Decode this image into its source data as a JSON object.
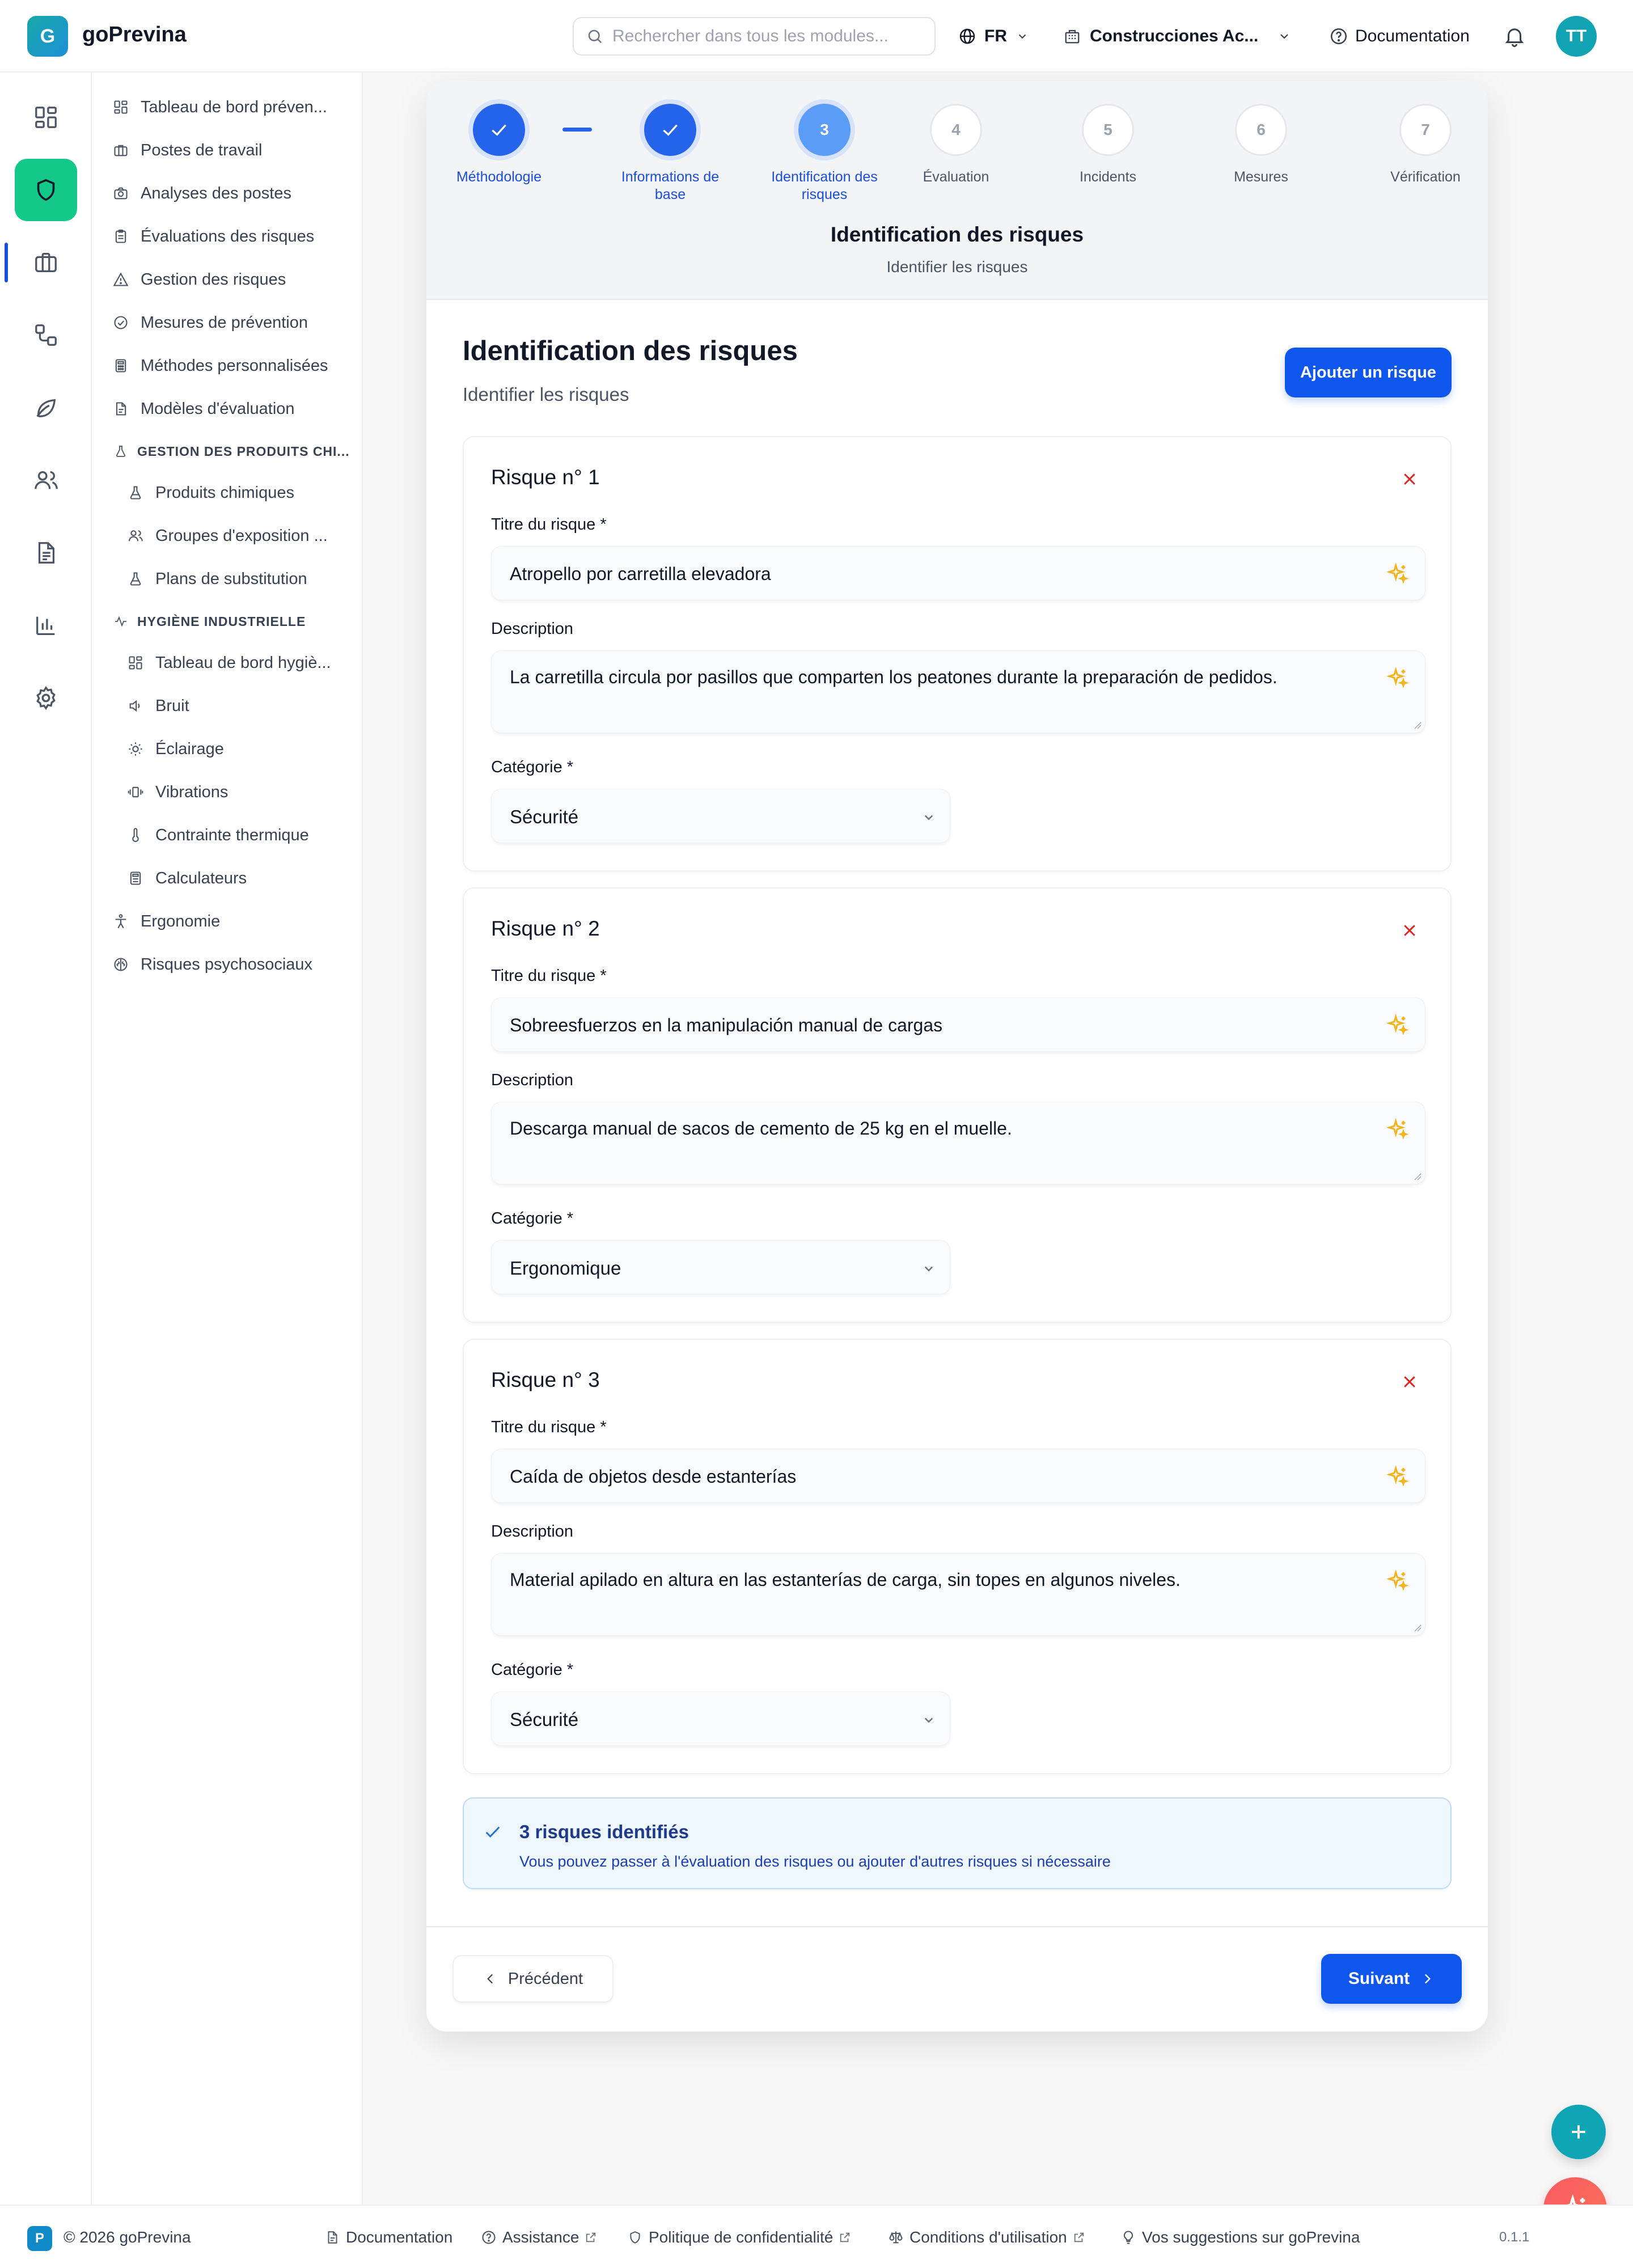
{
  "app": {
    "logo_letter": "G",
    "name": "goPrevina",
    "search_placeholder": "Rechercher dans tous les modules...",
    "language": "FR",
    "company": "Construcciones Ac...",
    "documentation": "Documentation",
    "avatar_initials": "TT"
  },
  "rail": {
    "icons": [
      "dashboard-icon",
      "shield-icon",
      "briefcase-icon",
      "workflow-icon",
      "leaf-icon",
      "users-icon",
      "document-icon",
      "bar-chart-icon",
      "settings-icon"
    ],
    "active_index": 1
  },
  "sidebar": {
    "items": [
      {
        "label": "Tableau de bord préven...",
        "icon": "dashboard-icon"
      },
      {
        "label": "Postes de travail",
        "icon": "briefcase-icon"
      },
      {
        "label": "Analyses des postes",
        "icon": "camera-icon"
      },
      {
        "label": "Évaluations des risques",
        "icon": "clipboard-icon"
      },
      {
        "label": "Gestion des risques",
        "icon": "warning-icon"
      },
      {
        "label": "Mesures de prévention",
        "icon": "check-circle-icon"
      },
      {
        "label": "Méthodes personnalisées",
        "icon": "calculator-icon"
      },
      {
        "label": "Modèles d'évaluation",
        "icon": "document-icon"
      }
    ],
    "chem_section": "GESTION DES PRODUITS CHI...",
    "chem_items": [
      {
        "label": "Produits chimiques",
        "icon": "flask-icon"
      },
      {
        "label": "Groupes d'exposition ...",
        "icon": "users-icon"
      },
      {
        "label": "Plans de substitution",
        "icon": "flask-icon"
      }
    ],
    "hyg_section": "HYGIÈNE INDUSTRIELLE",
    "hyg_items": [
      {
        "label": "Tableau de bord hygiè...",
        "icon": "dashboard-icon"
      },
      {
        "label": "Bruit",
        "icon": "speaker-icon"
      },
      {
        "label": "Éclairage",
        "icon": "sun-icon"
      },
      {
        "label": "Vibrations",
        "icon": "vibration-icon"
      },
      {
        "label": "Contrainte thermique",
        "icon": "thermometer-icon"
      },
      {
        "label": "Calculateurs",
        "icon": "calculator-icon"
      }
    ],
    "bottom_items": [
      {
        "label": "Ergonomie",
        "icon": "person-icon"
      },
      {
        "label": "Risques psychosociaux",
        "icon": "brain-icon"
      }
    ]
  },
  "wizard": {
    "steps": [
      {
        "num": "1",
        "label": "Méthodologie",
        "state": "done"
      },
      {
        "num": "2",
        "label": "Informations de base",
        "state": "done"
      },
      {
        "num": "3",
        "label": "Identification des risques",
        "state": "current"
      },
      {
        "num": "4",
        "label": "Évaluation",
        "state": "todo"
      },
      {
        "num": "5",
        "label": "Incidents",
        "state": "todo"
      },
      {
        "num": "6",
        "label": "Mesures",
        "state": "todo"
      },
      {
        "num": "7",
        "label": "Vérification",
        "state": "todo"
      }
    ],
    "header_title": "Identification des risques",
    "header_subtitle": "Identifier les risques",
    "section_title": "Identification des risques",
    "section_subtitle": "Identifier les risques",
    "add_button": "Ajouter un risque",
    "labels": {
      "title": "Titre du risque *",
      "description": "Description",
      "category": "Catégorie *"
    },
    "risks": [
      {
        "heading": "Risque n° 1",
        "title": "Atropello por carretilla elevadora",
        "description": "La carretilla circula por pasillos que comparten los peatones durante la preparación de pedidos.",
        "category": "Sécurité"
      },
      {
        "heading": "Risque n° 2",
        "title": "Sobreesfuerzos en la manipulación manual de cargas",
        "description": "Descarga manual de sacos de cemento de 25 kg en el muelle.",
        "category": "Ergonomique"
      },
      {
        "heading": "Risque n° 3",
        "title": "Caída de objetos desde estanterías",
        "description": "Material apilado en altura en las estanterías de carga, sin topes en algunos niveles.",
        "category": "Sécurité"
      }
    ],
    "info_title": "3 risques identifiés",
    "info_text": "Vous pouvez passer à l'évaluation des risques ou ajouter d'autres risques si nécessaire",
    "prev_button": "Précédent",
    "next_button": "Suivant"
  },
  "footer": {
    "logo_letter": "P",
    "copyright": "© 2026 goPrevina",
    "documentation": "Documentation",
    "assistance": "Assistance",
    "privacy": "Politique de confidentialité",
    "terms": "Conditions d'utilisation",
    "suggestions": "Vos suggestions sur goPrevina",
    "version": "0.1.1"
  },
  "colors": {
    "primary": "#0f57ec",
    "accent_green": "#12c98a",
    "danger": "#dc2626",
    "sparkle": "#f4b21c"
  }
}
